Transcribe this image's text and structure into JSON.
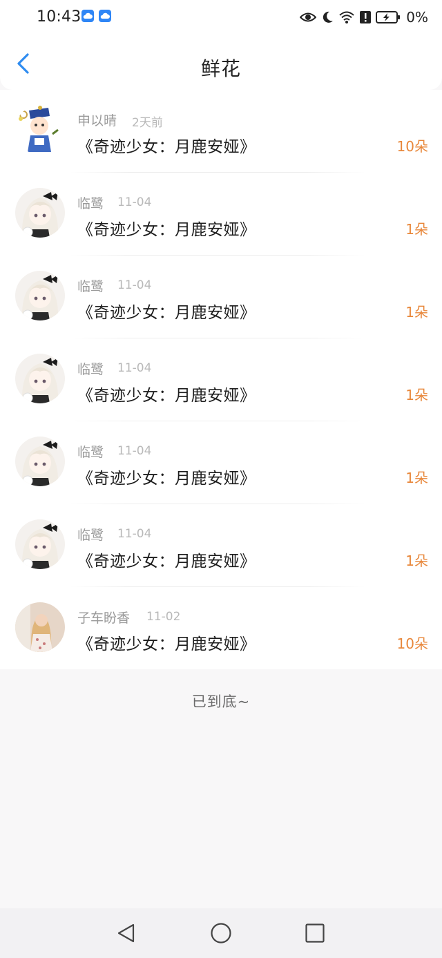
{
  "status_bar": {
    "time": "10:43",
    "battery": "0%",
    "icons": [
      "cloud-icon",
      "cloud-icon",
      "eye-icon",
      "moon-icon",
      "wifi-icon",
      "alert-icon",
      "battery-charging-icon"
    ]
  },
  "header": {
    "title": "鲜花",
    "back_icon": "chevron-left-icon"
  },
  "flowers": [
    {
      "name": "申以晴",
      "time": "2天前",
      "book": "《奇迹少女：月鹿安娅》",
      "count": "10朵",
      "avatar": "cartoon-avatar"
    },
    {
      "name": "临鹭",
      "time": "11-04",
      "book": "《奇迹少女：月鹿安娅》",
      "count": "1朵",
      "avatar": "anime-girl-avatar"
    },
    {
      "name": "临鹭",
      "time": "11-04",
      "book": "《奇迹少女：月鹿安娅》",
      "count": "1朵",
      "avatar": "anime-girl-avatar"
    },
    {
      "name": "临鹭",
      "time": "11-04",
      "book": "《奇迹少女：月鹿安娅》",
      "count": "1朵",
      "avatar": "anime-girl-avatar"
    },
    {
      "name": "临鹭",
      "time": "11-04",
      "book": "《奇迹少女：月鹿安娅》",
      "count": "1朵",
      "avatar": "anime-girl-avatar"
    },
    {
      "name": "临鹭",
      "time": "11-04",
      "book": "《奇迹少女：月鹿安娅》",
      "count": "1朵",
      "avatar": "anime-girl-avatar"
    },
    {
      "name": "子车盼香",
      "time": "11-02",
      "book": "《奇迹少女：月鹿安娅》",
      "count": "10朵",
      "avatar": "photo-avatar"
    }
  ],
  "footer": {
    "end_text": "已到底~"
  },
  "colors": {
    "accent": "#2f8cf0",
    "count": "#e8873a",
    "muted": "#9a9a9a",
    "background": "#f8f7f8"
  },
  "nav": {
    "icons": [
      "back-triangle-icon",
      "home-circle-icon",
      "recents-square-icon"
    ]
  }
}
